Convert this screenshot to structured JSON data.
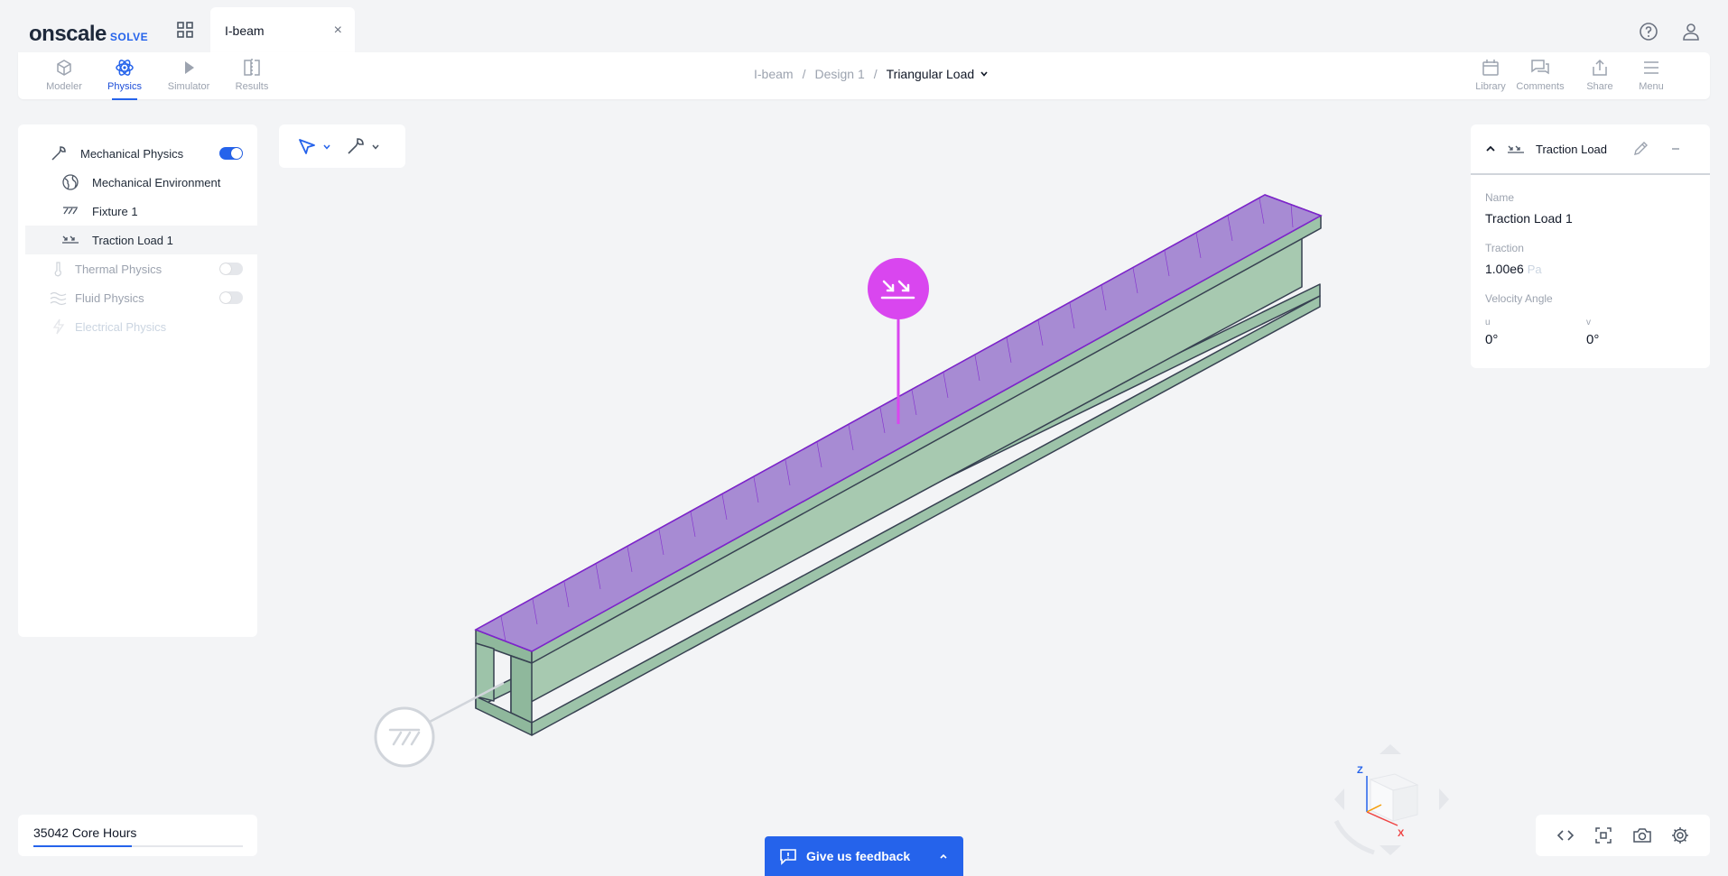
{
  "app": {
    "brand": "onscale",
    "product": "SOLVE"
  },
  "file_tab": {
    "title": "I-beam",
    "close": "×"
  },
  "nav": {
    "items": [
      {
        "label": "Modeler",
        "icon": "cube-icon"
      },
      {
        "label": "Physics",
        "icon": "atom-icon"
      },
      {
        "label": "Simulator",
        "icon": "play-icon"
      },
      {
        "label": "Results",
        "icon": "split-view-icon"
      }
    ],
    "active": "Physics",
    "right_items": [
      {
        "label": "Library",
        "icon": "calendar-icon"
      },
      {
        "label": "Comments",
        "icon": "chat-icon"
      },
      {
        "label": "Share",
        "icon": "share-icon"
      },
      {
        "label": "Menu",
        "icon": "hamburger-icon"
      }
    ]
  },
  "breadcrumb": {
    "project": "I-beam",
    "sep": "/",
    "design": "Design 1",
    "current": "Triangular Load"
  },
  "physics_tree": {
    "mechanical": {
      "label": "Mechanical Physics",
      "enabled": true
    },
    "children": [
      {
        "label": "Mechanical Environment",
        "icon": "globe-icon"
      },
      {
        "label": "Fixture 1",
        "icon": "fixture-hatch-icon"
      },
      {
        "label": "Traction Load 1",
        "icon": "traction-load-icon"
      }
    ],
    "thermal": {
      "label": "Thermal Physics",
      "enabled": false
    },
    "fluid": {
      "label": "Fluid Physics",
      "enabled": false
    },
    "electrical": {
      "label": "Electrical Physics",
      "enabled": false
    }
  },
  "core_hours": {
    "text": "35042 Core Hours",
    "usage_fraction": 0.47
  },
  "properties": {
    "header": "Traction Load",
    "name_label": "Name",
    "name_value": "Traction Load 1",
    "traction_label": "Traction",
    "traction_value": "1.00e6",
    "traction_unit": "Pa",
    "velocity_label": "Velocity Angle",
    "u_label": "u",
    "u_value": "0°",
    "v_label": "v",
    "v_value": "0°"
  },
  "view_cube": {
    "z_label": "Z",
    "x_label": "X"
  },
  "feedback": {
    "label": "Give us feedback"
  },
  "colors": {
    "accent": "#2563eb",
    "beam": "#a7c9b0",
    "load": "#a78bd3",
    "marker": "#d946ef"
  }
}
